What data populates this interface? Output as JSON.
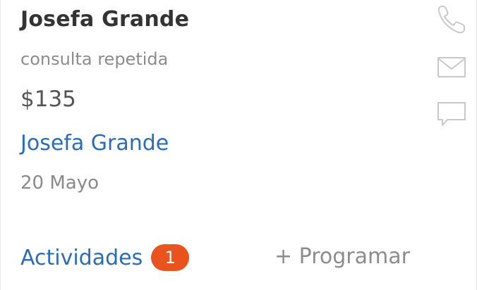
{
  "deal": {
    "title": "Josefa Grande",
    "subject": "consulta repetida",
    "amount": "$135",
    "contact_name": "Josefa Grande",
    "date": "20 Mayo"
  },
  "actions": {
    "icons": [
      "phone-icon",
      "mail-icon",
      "chat-icon"
    ],
    "icon_color": "#c8c8c8"
  },
  "footer": {
    "activities_label": "Actividades",
    "activities_count": "1",
    "schedule_label": "+ Programar"
  },
  "colors": {
    "link": "#2a6db5",
    "badge": "#e8531e",
    "title": "#333333",
    "muted": "#8c8c8c"
  }
}
